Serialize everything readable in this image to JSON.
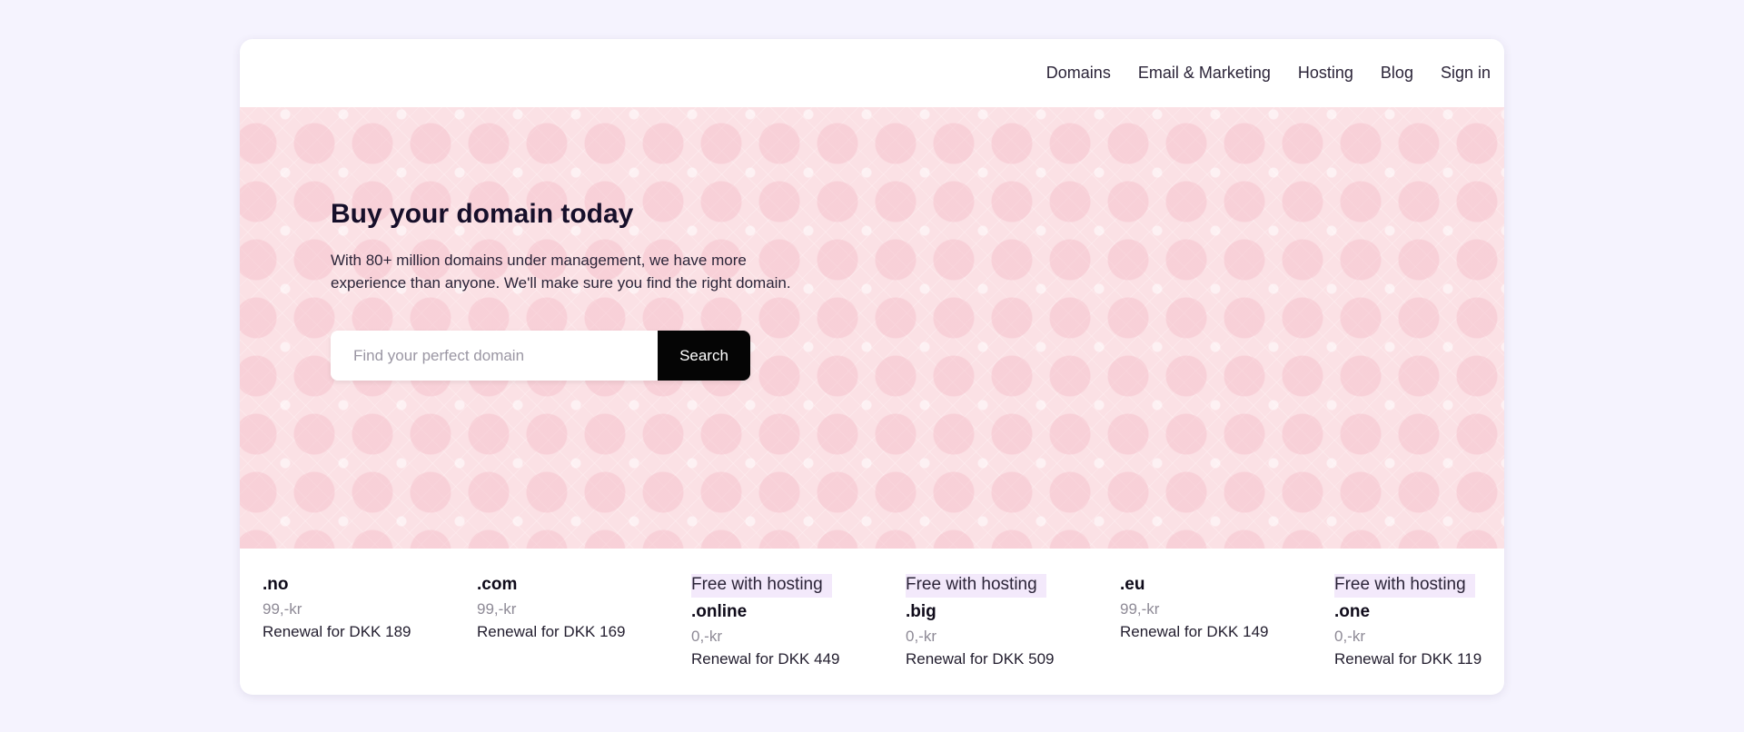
{
  "nav": {
    "items": [
      "Domains",
      "Email & Marketing",
      "Hosting",
      "Blog",
      "Sign in"
    ]
  },
  "hero": {
    "title": "Buy your domain today",
    "subtitle": "With 80+ million domains under management, we have more experience than anyone. We'll make sure you find the right domain.",
    "search_placeholder": "Find your perfect domain",
    "search_value": "",
    "search_button": "Search"
  },
  "tlds": [
    {
      "badge": "",
      "name": ".no",
      "price": "99,-kr",
      "renewal": "Renewal for DKK 189"
    },
    {
      "badge": "",
      "name": ".com",
      "price": "99,-kr",
      "renewal": "Renewal for DKK 169"
    },
    {
      "badge": "Free with hosting",
      "name": ".online",
      "price": "0,-kr",
      "renewal": "Renewal for DKK 449"
    },
    {
      "badge": "Free with hosting",
      "name": ".big",
      "price": "0,-kr",
      "renewal": "Renewal for DKK 509"
    },
    {
      "badge": "",
      "name": ".eu",
      "price": "99,-kr",
      "renewal": "Renewal for DKK 149"
    },
    {
      "badge": "Free with hosting",
      "name": ".one",
      "price": "0,-kr",
      "renewal": "Renewal for DKK 119"
    }
  ],
  "colors": {
    "page_background": "#f5f3fe",
    "hero_background": "#fbe1e5",
    "badge_background": "#f3e9fb",
    "button_background": "#050505"
  }
}
